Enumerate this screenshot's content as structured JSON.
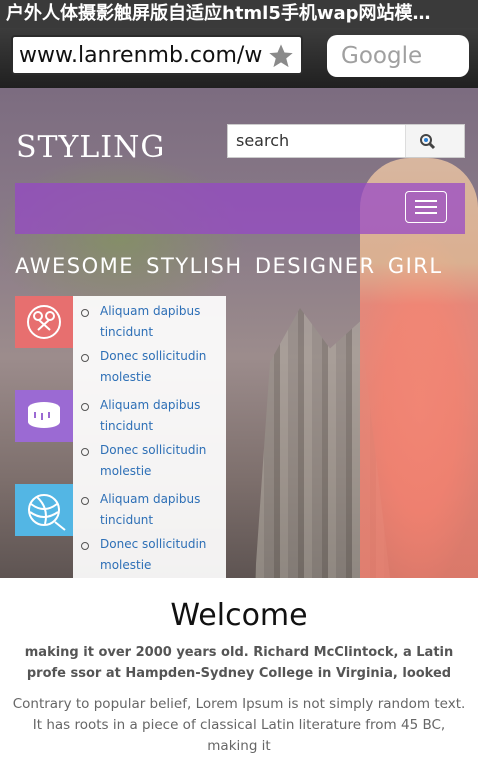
{
  "browser": {
    "title": "户外人体摄影触屏版自适应html5手机wap网站模…",
    "url": "www.lanrenmb.com/w",
    "search_placeholder": "Google"
  },
  "site": {
    "logo": "STYLING",
    "search_value": "search",
    "headline": "AWESOME  STYLISH  DESIGNER  GIRL",
    "sidebar": [
      {
        "icon": "scissors-icon",
        "color": "#e76f6f",
        "links": [
          "Aliquam dapibus tincidunt",
          "Donec sollicitudin molestie"
        ]
      },
      {
        "icon": "measuring-tape-icon",
        "color": "#9b6ad3",
        "links": [
          "Aliquam dapibus tincidunt",
          "Donec sollicitudin molestie"
        ]
      },
      {
        "icon": "yarn-ball-icon",
        "color": "#53b6e4",
        "links": [
          "Aliquam dapibus tincidunt",
          "Donec sollicitudin molestie"
        ]
      }
    ],
    "nav_color": "#9646c8"
  },
  "content": {
    "heading": "Welcome",
    "subtitle": "making it over 2000 years old. Richard McClintock, a Latin profe ssor at Hampden-Sydney College in Virginia, looked",
    "paragraph": "Contrary to popular belief, Lorem Ipsum is not simply random text. It has roots in a piece of classical Latin literature from 45 BC, making it"
  }
}
